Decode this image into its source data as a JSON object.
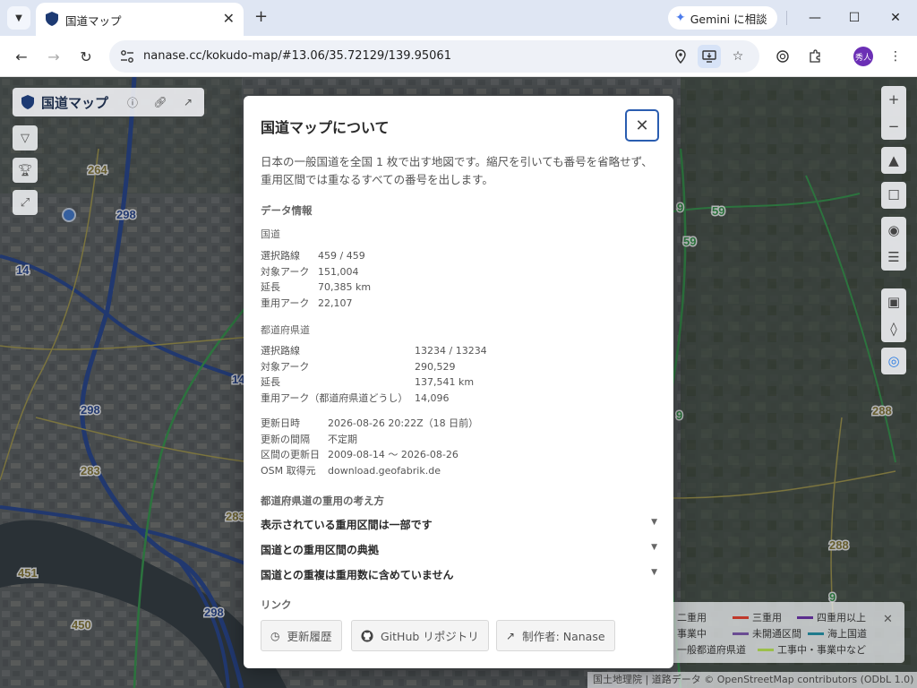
{
  "browser": {
    "tab_title": "国道マップ",
    "url": "nanase.cc/kokudo-map/#13.06/35.72129/139.95061",
    "gemini_label": "Gemini に相談",
    "avatar_text": "秀人"
  },
  "map": {
    "panel_title": "国道マップ",
    "route_labels": [
      "264",
      "298",
      "14",
      "298",
      "283",
      "283",
      "451",
      "450",
      "298",
      "59",
      "59",
      "9",
      "9",
      "288",
      "288",
      "9",
      "14"
    ],
    "legend": [
      {
        "label": "二重用",
        "color": "#d98a2b"
      },
      {
        "label": "三重用",
        "color": "#c0392b"
      },
      {
        "label": "四重用以上",
        "color": "#5b2d8e"
      },
      {
        "label": "事業中",
        "color": "#8a8a8a"
      },
      {
        "label": "未開通区間",
        "color": "#6a4c93"
      },
      {
        "label": "海上国道",
        "color": "#1f7a8c"
      },
      {
        "label": "一般都道府県道",
        "color": "#c9b458"
      },
      {
        "label": "工事中・事業中など",
        "color": "#9bbf4a"
      }
    ],
    "attribution": "国土地理院 | 道路データ © OpenStreetMap contributors (ODbL 1.0)"
  },
  "modal": {
    "title": "国道マップについて",
    "intro": "日本の一般国道を全国 1 枚で出す地図です。縮尺を引いても番号を省略せず、 重用区間では重なるすべての番号を出します。",
    "data_heading": "データ情報",
    "national": {
      "heading": "国道",
      "rows": [
        {
          "k": "選択路線",
          "v": "459 / 459"
        },
        {
          "k": "対象アーク",
          "v": "151,004"
        },
        {
          "k": "延長",
          "v": "70,385 km"
        },
        {
          "k": "重用アーク",
          "v": "22,107"
        }
      ]
    },
    "prefectural": {
      "heading": "都道府県道",
      "rows": [
        {
          "k": "選択路線",
          "v": "13234 / 13234"
        },
        {
          "k": "対象アーク",
          "v": "290,529"
        },
        {
          "k": "延長",
          "v": "137,541 km"
        },
        {
          "k": "重用アーク（都道府県道どうし）",
          "v": "14,096"
        }
      ]
    },
    "update": {
      "rows": [
        {
          "k": "更新日時",
          "v": "2026-08-26 20:22Z（18 日前）"
        },
        {
          "k": "更新の間隔",
          "v": "不定期"
        },
        {
          "k": "区間の更新日",
          "v": "2009-08-14 〜 2026-08-26"
        },
        {
          "k": "OSM 取得元",
          "v": "download.geofabrik.de"
        }
      ]
    },
    "overlap_heading": "都道府県道の重用の考え方",
    "accordions": [
      "表示されている重用区間は一部です",
      "国道との重用区間の典拠",
      "国道との重複は重用数に含めていません"
    ],
    "links_heading": "リンク",
    "links": [
      {
        "icon": "clock-icon",
        "label": "更新履歴"
      },
      {
        "icon": "github-icon",
        "label": "GitHub リポジトリ"
      },
      {
        "icon": "external-link-icon",
        "label": "制作者: Nanase"
      }
    ]
  }
}
